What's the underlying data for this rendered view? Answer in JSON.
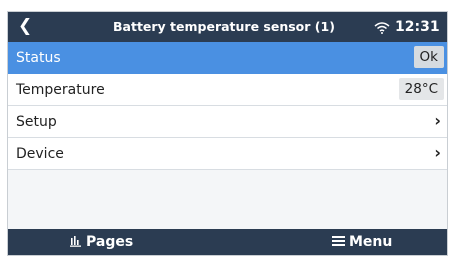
{
  "header": {
    "title": "Battery temperature sensor (1)",
    "time": "12:31",
    "back_icon": "chevron-left-icon",
    "signal_icon": "wifi-icon"
  },
  "rows": [
    {
      "label": "Status",
      "value": "Ok",
      "selected": true
    },
    {
      "label": "Temperature",
      "value": "28°C"
    },
    {
      "label": "Setup",
      "chevron": "›"
    },
    {
      "label": "Device",
      "chevron": "›"
    }
  ],
  "footer": {
    "pages_label": "Pages",
    "pages_icon": "bar-chart-icon",
    "menu_label": "Menu",
    "menu_icon": "hamburger-icon"
  },
  "colors": {
    "bar": "#2b3c52",
    "selected_row": "#4a90e2",
    "background": "#f4f6f8"
  }
}
